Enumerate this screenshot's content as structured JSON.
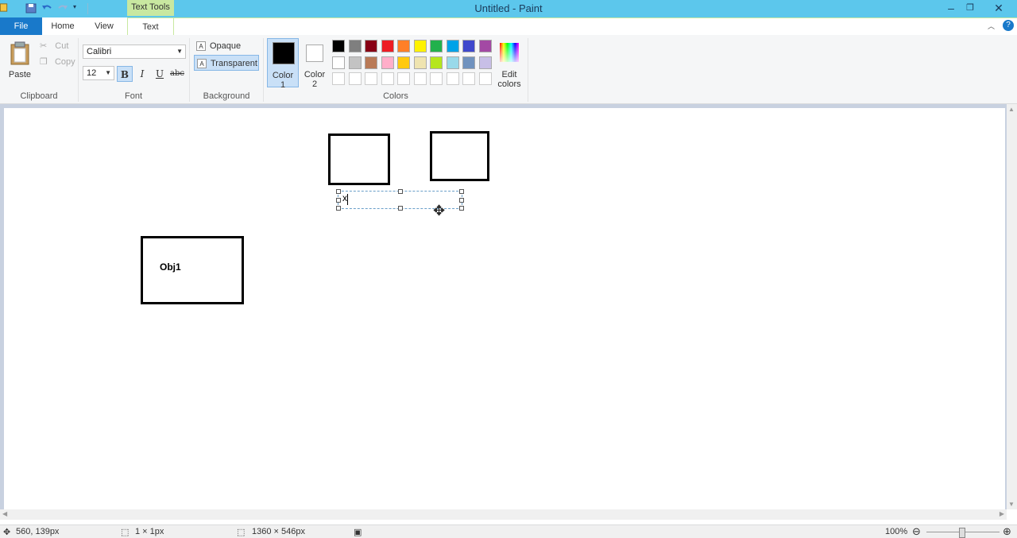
{
  "window": {
    "title": "Untitled - Paint",
    "context_tab": "Text Tools"
  },
  "ribbon_tabs": [
    "File",
    "Home",
    "View",
    "Text"
  ],
  "clipboard": {
    "paste": "Paste",
    "cut": "Cut",
    "copy": "Copy",
    "group": "Clipboard"
  },
  "font": {
    "family": "Calibri",
    "size": "12",
    "bold": "B",
    "italic": "I",
    "underline": "U",
    "strikethrough": "abc",
    "group": "Font"
  },
  "background": {
    "opaque": "Opaque",
    "transparent": "Transparent",
    "group": "Background"
  },
  "colors": {
    "color1": "Color\n1",
    "color1_line1": "Color",
    "color1_line2": "1",
    "color2_line1": "Color",
    "color2_line2": "2",
    "edit_line1": "Edit",
    "edit_line2": "colors",
    "group": "Colors",
    "color1_value": "#000000",
    "color2_value": "#ffffff",
    "palette_row1": [
      "#000000",
      "#7f7f7f",
      "#880015",
      "#ed1c24",
      "#ff7f27",
      "#fff200",
      "#22b14c",
      "#00a2e8",
      "#3f48cc",
      "#a349a4"
    ],
    "palette_row2": [
      "#ffffff",
      "#c3c3c3",
      "#b97a57",
      "#ffaec9",
      "#ffc90e",
      "#efe4b0",
      "#b5e61d",
      "#99d9ea",
      "#7092be",
      "#c8bfe7"
    ],
    "palette_row3": [
      "#ffffff",
      "#ffffff",
      "#ffffff",
      "#ffffff",
      "#ffffff",
      "#ffffff",
      "#ffffff",
      "#ffffff",
      "#ffffff",
      "#ffffff"
    ]
  },
  "canvas": {
    "box_label": "Obj1",
    "text_input": "x"
  },
  "status": {
    "cursor": "560, 139px",
    "selection": "1 × 1px",
    "size": "1360 × 546px",
    "zoom": "100%"
  }
}
